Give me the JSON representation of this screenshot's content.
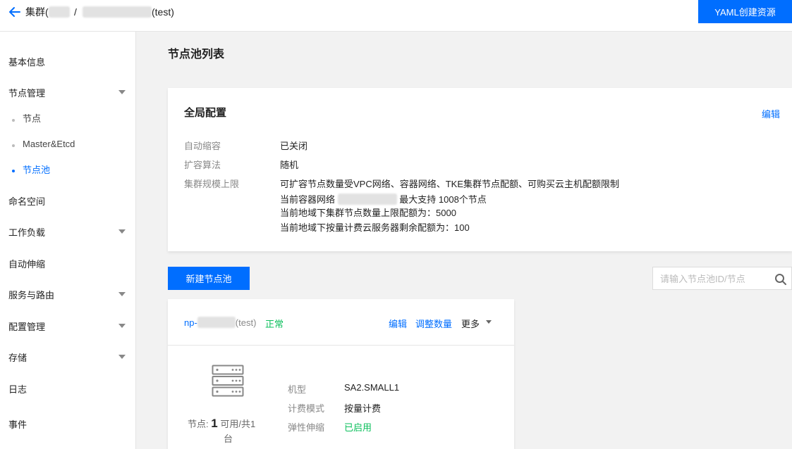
{
  "header": {
    "crumb_prefix": "集群(",
    "separator": "/",
    "crumb_suffix": "(test)",
    "yaml_button": "YAML创建资源"
  },
  "sidebar": {
    "items": [
      {
        "label": "基本信息"
      },
      {
        "label": "节点管理",
        "expandable": true
      },
      {
        "label": "命名空间"
      },
      {
        "label": "工作负载",
        "expandable": true
      },
      {
        "label": "自动伸缩"
      },
      {
        "label": "服务与路由",
        "expandable": true
      },
      {
        "label": "配置管理",
        "expandable": true
      },
      {
        "label": "存储",
        "expandable": true
      },
      {
        "label": "日志"
      },
      {
        "label": "事件"
      }
    ],
    "subitems": [
      {
        "label": "节点"
      },
      {
        "label": "Master&Etcd"
      },
      {
        "label": "节点池",
        "active": true
      }
    ]
  },
  "main": {
    "title": "节点池列表",
    "global_config": {
      "title": "全局配置",
      "edit": "编辑",
      "rows": [
        {
          "label": "自动缩容",
          "value": "已关闭"
        },
        {
          "label": "扩容算法",
          "value": "随机"
        },
        {
          "label": "集群规模上限",
          "value": "可扩容节点数量受VPC网络、容器网络、TKE集群节点配额、可购买云主机配额限制"
        }
      ],
      "limit_lines": {
        "network_prefix": "当前容器网络",
        "network_suffix": "最大支持 1008个节点",
        "line3": "当前地域下集群节点数量上限配额为：5000",
        "line4": "当前地域下按量计费云服务器剩余配额为：100"
      }
    },
    "new_pool_button": "新建节点池",
    "search": {
      "placeholder": "请输入节点池ID/节点"
    },
    "pool": {
      "name_prefix": "np-",
      "name_suffix": "(test)",
      "status": "正常",
      "actions": {
        "edit": "编辑",
        "adjust": "调整数量",
        "more": "更多"
      },
      "nodes_label": "节点:",
      "nodes_available": "1",
      "nodes_text": "可用/共1",
      "nodes_unit": "台",
      "specs": [
        {
          "label": "机型",
          "value": "SA2.SMALL1"
        },
        {
          "label": "计费模式",
          "value": "按量计费"
        },
        {
          "label": "弹性伸缩",
          "value": "已启用"
        }
      ]
    }
  },
  "colors": {
    "accent": "#006eff",
    "success": "#0abf5b"
  }
}
